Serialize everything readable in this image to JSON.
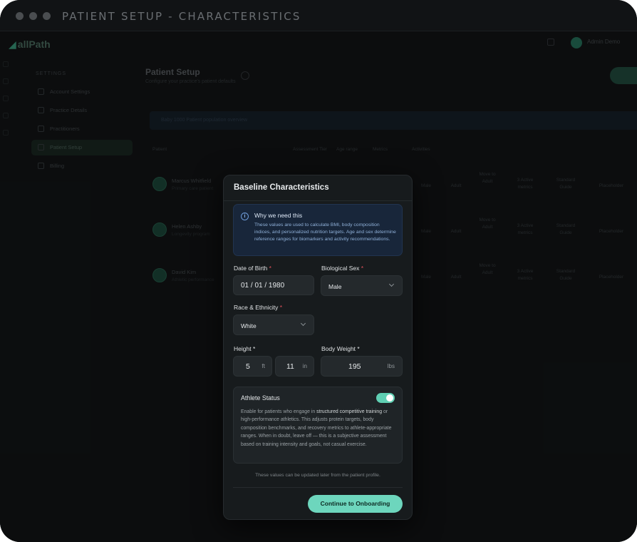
{
  "window": {
    "title": "PATIENT SETUP - CHARACTERISTICS"
  },
  "background": {
    "logo": "allPath",
    "user_name": "Admin Demo",
    "sidebar_heading": "SETTINGS",
    "sidebar_items": [
      {
        "label": "Account Settings",
        "active": false
      },
      {
        "label": "Practice Details",
        "active": false
      },
      {
        "label": "Practitioners",
        "active": false
      },
      {
        "label": "Patient Setup",
        "active": true
      },
      {
        "label": "Billing",
        "active": false
      }
    ],
    "page_title": "Patient Setup",
    "page_subtitle": "Configure your practice's patient defaults",
    "banner_text": "Baby 1000 Patient population overview",
    "columns": [
      "Patient",
      "Assessment Tier",
      "Age range",
      "Metrics",
      "Activities"
    ],
    "rows": [
      {
        "name": "Marcus Whitfield",
        "sub": "Primary care patient",
        "cells": [
          "Male",
          "Adult",
          "Move to Adult",
          "3 Active metrics",
          "Standard Guide",
          "Placeholder"
        ]
      },
      {
        "name": "Helen Ashby",
        "sub": "Longevity program",
        "cells": [
          "Male",
          "Adult",
          "Move to Adult",
          "3 Active metrics",
          "Standard Guide",
          "Placeholder"
        ]
      },
      {
        "name": "David Kim",
        "sub": "Athletic performance",
        "cells": [
          "Male",
          "Adult",
          "Move to Adult",
          "3 Active metrics",
          "Standard Guide",
          "Placeholder"
        ]
      }
    ]
  },
  "modal": {
    "title": "Baseline Characteristics",
    "info": {
      "icon": "info-icon",
      "title": "Why we need this",
      "text": "These values are used to calculate BMI, body composition indices, and personalized nutrition targets. Age and sex determine reference ranges for biomarkers and activity recommendations."
    },
    "dob": {
      "label": "Date of Birth",
      "required": "*",
      "value": "01 / 01 / 1980"
    },
    "sex": {
      "label": "Biological Sex",
      "required": "*",
      "value": "Male"
    },
    "race": {
      "label": "Race & Ethnicity",
      "required": "*",
      "value": "White"
    },
    "height": {
      "label": "Height",
      "required": "*",
      "feet": "5",
      "feet_unit": "ft",
      "inches": "11",
      "inches_unit": "in"
    },
    "weight": {
      "label": "Body Weight",
      "required": "*",
      "value": "195",
      "unit": "lbs"
    },
    "athlete": {
      "title": "Athlete Status",
      "enabled": true,
      "text_before": "Enable for patients who engage in ",
      "text_emphasis": "structured competitive training",
      "text_after": " or high-performance athletics. This adjusts protein targets, body composition benchmarks, and recovery metrics to athlete-appropriate ranges. When in doubt, leave off — this is a subjective assessment based on training intensity and goals, not casual exercise."
    },
    "footnote": "These values can be updated later from the patient profile.",
    "cta": "Continue to Onboarding"
  }
}
